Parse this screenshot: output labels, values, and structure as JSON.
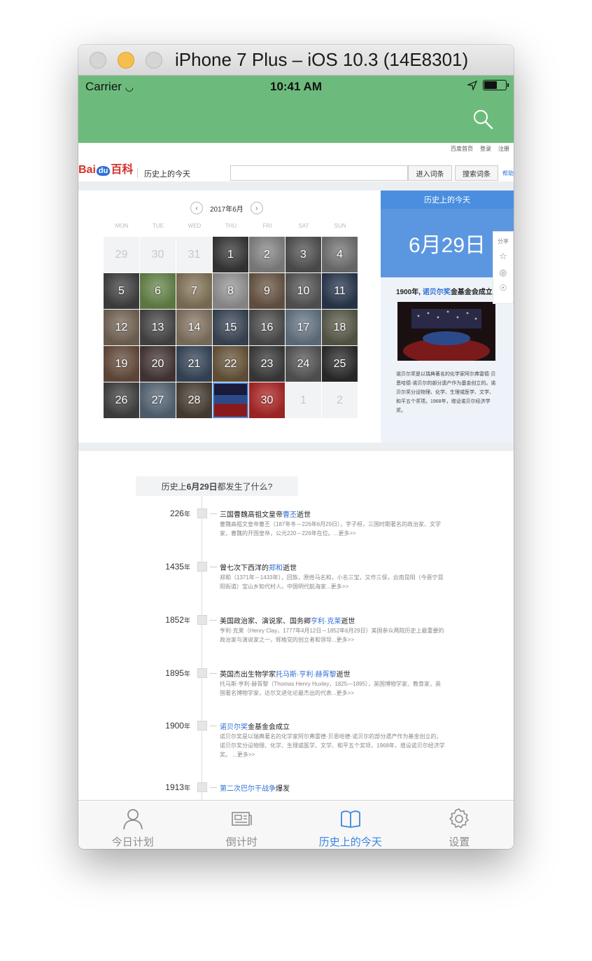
{
  "window": {
    "title": "iPhone 7 Plus – iOS 10.3 (14E8301)"
  },
  "statusbar": {
    "carrier": "Carrier",
    "time": "10:41 AM"
  },
  "baike": {
    "top_links": [
      "百度首页",
      "登录",
      "注册"
    ],
    "logo_text_left": "Bai",
    "logo_text_du": "du",
    "logo_text_right": "百科",
    "section": "历史上的今天",
    "enter_button": "进入词条",
    "search_button": "搜索词条",
    "help": "帮助"
  },
  "calendar": {
    "month_label": "2017年6月",
    "weekdays": [
      "MON",
      "TUE",
      "WED",
      "THU",
      "FRI",
      "SAT",
      "SUN"
    ],
    "days": [
      {
        "n": "29",
        "off": true,
        "c": ""
      },
      {
        "n": "30",
        "off": true,
        "c": ""
      },
      {
        "n": "31",
        "off": true,
        "c": ""
      },
      {
        "n": "1",
        "off": false,
        "c": "#3a3a3a"
      },
      {
        "n": "2",
        "off": false,
        "c": "#8a8a8a"
      },
      {
        "n": "3",
        "off": false,
        "c": "#555555"
      },
      {
        "n": "4",
        "off": false,
        "c": "#777777"
      },
      {
        "n": "5",
        "off": false,
        "c": "#444444"
      },
      {
        "n": "6",
        "off": false,
        "c": "#6b8a4e"
      },
      {
        "n": "7",
        "off": false,
        "c": "#8a7a5e"
      },
      {
        "n": "8",
        "off": false,
        "c": "#9a9a9a"
      },
      {
        "n": "9",
        "off": false,
        "c": "#6e5a48"
      },
      {
        "n": "10",
        "off": false,
        "c": "#5a5a5a"
      },
      {
        "n": "11",
        "off": false,
        "c": "#2c3a52"
      },
      {
        "n": "12",
        "off": false,
        "c": "#7a6a5a"
      },
      {
        "n": "13",
        "off": false,
        "c": "#4a4a4a"
      },
      {
        "n": "14",
        "off": false,
        "c": "#8a7a68"
      },
      {
        "n": "15",
        "off": false,
        "c": "#3e4a5a"
      },
      {
        "n": "16",
        "off": false,
        "c": "#505050"
      },
      {
        "n": "17",
        "off": false,
        "c": "#6a7a8a"
      },
      {
        "n": "18",
        "off": false,
        "c": "#5e5e4e"
      },
      {
        "n": "19",
        "off": false,
        "c": "#6a5040"
      },
      {
        "n": "20",
        "off": false,
        "c": "#4a3a3a"
      },
      {
        "n": "21",
        "off": false,
        "c": "#3a4a5e"
      },
      {
        "n": "22",
        "off": false,
        "c": "#6e5a3e"
      },
      {
        "n": "23",
        "off": false,
        "c": "#3e3e3e"
      },
      {
        "n": "24",
        "off": false,
        "c": "#5a5a5a"
      },
      {
        "n": "25",
        "off": false,
        "c": "#2e2e2e"
      },
      {
        "n": "26",
        "off": false,
        "c": "#454545"
      },
      {
        "n": "27",
        "off": false,
        "c": "#5a6a7a"
      },
      {
        "n": "28",
        "off": false,
        "c": "#4e4438"
      },
      {
        "n": "",
        "off": false,
        "c": "#2c3a6a",
        "sel": true
      },
      {
        "n": "30",
        "off": false,
        "c": "#b42a2a"
      },
      {
        "n": "1",
        "off": true,
        "c": ""
      },
      {
        "n": "2",
        "off": true,
        "c": ""
      }
    ]
  },
  "sidebar": {
    "title": "历史上的今天",
    "date": "6月29日",
    "headline_year": "1900年,",
    "headline_link": "诺贝尔奖",
    "headline_rest": "金基金会成立",
    "description": "诺贝尔奖是以瑞典著名的化学家阿尔弗雷德·贝恩哈德·诺贝尔的部分遗产作为基金创立的。诺贝尔奖分设物理、化学、生理或医学、文学、和平五个奖项。1968年，增设诺贝尔经济学奖。",
    "share_label": "分享"
  },
  "timeline": {
    "heading_pre": "历史上",
    "heading_date": "6月29日",
    "heading_post": "都发生了什么?",
    "events": [
      {
        "year": "226",
        "unit": "年",
        "title_pre": "三国曹魏高祖文皇帝",
        "title_link": "曹丕",
        "title_post": "逝世",
        "body": "曹魏高祖文皇帝曹丕（187年冬－226年6月29日），字子桓，三国时期著名的政治家、文学家，曹魏的开国皇帝，公元220－226年在位。...更多>>"
      },
      {
        "year": "1435",
        "unit": "年",
        "title_pre": "曾七次下西洋的",
        "title_link": "郑和",
        "title_post": "逝世",
        "body": "郑和（1371年－1433年），回族，原姓马名和，小名三宝，又作三保，云南昆阳（今晋宁昆阳街道）宝山乡知代村人。中国明代航海家...更多>>"
      },
      {
        "year": "1852",
        "unit": "年",
        "title_pre": "美国政治家、演说家、国务卿",
        "title_link": "亨利·克莱",
        "title_post": "逝世",
        "body": "亨利·克莱（Henry Clay，1777年4月12日－1852年6月29日）美国参众两院历史上最重要的政治家与演说家之一，辉格党的创立者和领导...更多>>"
      },
      {
        "year": "1895",
        "unit": "年",
        "title_pre": "英国杰出生物学家",
        "title_link": "托马斯·亨利·赫胥黎",
        "title_post": "逝世",
        "body": "托马斯·亨利·赫胥黎（Thomas Henry Huxley，1825—1895），英国博物学家、教育家，英国著名博物学家，达尔文进化论最杰出的代表...更多>>"
      },
      {
        "year": "1900",
        "unit": "年",
        "title_pre": "",
        "title_link": "诺贝尔奖",
        "title_post": "金基金会成立",
        "body": "诺贝尔奖是以瑞典著名的化学家阿尔弗雷德·贝恩哈德·诺贝尔的部分遗产作为基金创立的，诺贝尔奖分设物理、化学、生理或医学、文学、和平五个奖项，1968年，增设诺贝尔经济学奖。 ...更多>>"
      },
      {
        "year": "1913",
        "unit": "年",
        "title_pre": "",
        "title_link": "第二次巴尔干战争",
        "title_post": "爆发",
        "body": ""
      }
    ]
  },
  "tabbar": {
    "tabs": [
      {
        "label": "今日计划",
        "icon": "person-icon"
      },
      {
        "label": "倒计时",
        "icon": "newspaper-icon"
      },
      {
        "label": "历史上的今天",
        "icon": "book-icon"
      },
      {
        "label": "设置",
        "icon": "gear-icon"
      }
    ],
    "active_index": 2,
    "active_color": "#3a86e0",
    "inactive_color": "#8d8d8d"
  },
  "colors": {
    "navbar": "#6dbb7c",
    "accent": "#4a8ee0"
  }
}
